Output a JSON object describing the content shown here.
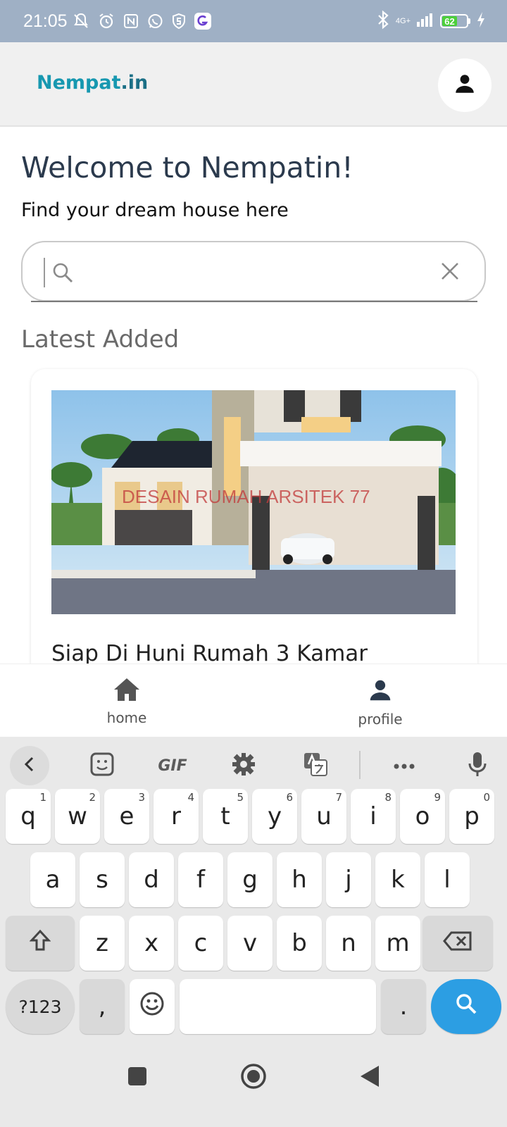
{
  "status_bar": {
    "time": "21:05",
    "network": "4G+",
    "battery": "62"
  },
  "app": {
    "brand": "Nempat",
    "brand_suffix": ".in"
  },
  "home": {
    "title": "Welcome to Nempatin!",
    "subtitle": "Find your dream house here",
    "search_value": "",
    "section_title": "Latest Added",
    "listing_title": "Siap Di Huni Rumah 3 Kamar",
    "watermark": "DESAIN RUMAH ARSITEK 77"
  },
  "nav": {
    "home": "home",
    "profile": "profile"
  },
  "keyboard": {
    "gif_label": "GIF",
    "row1": [
      {
        "k": "q",
        "h": "1"
      },
      {
        "k": "w",
        "h": "2"
      },
      {
        "k": "e",
        "h": "3"
      },
      {
        "k": "r",
        "h": "4"
      },
      {
        "k": "t",
        "h": "5"
      },
      {
        "k": "y",
        "h": "6"
      },
      {
        "k": "u",
        "h": "7"
      },
      {
        "k": "i",
        "h": "8"
      },
      {
        "k": "o",
        "h": "9"
      },
      {
        "k": "p",
        "h": "0"
      }
    ],
    "row2": [
      "a",
      "s",
      "d",
      "f",
      "g",
      "h",
      "j",
      "k",
      "l"
    ],
    "row3": [
      "z",
      "x",
      "c",
      "v",
      "b",
      "n",
      "m"
    ],
    "symbols_label": "?123",
    "comma": ",",
    "period": "."
  },
  "colors": {
    "brand": "#1798b0",
    "status_bar": "#9fb0c5",
    "search_key": "#2c9ee3",
    "battery": "#4ccf3a"
  }
}
